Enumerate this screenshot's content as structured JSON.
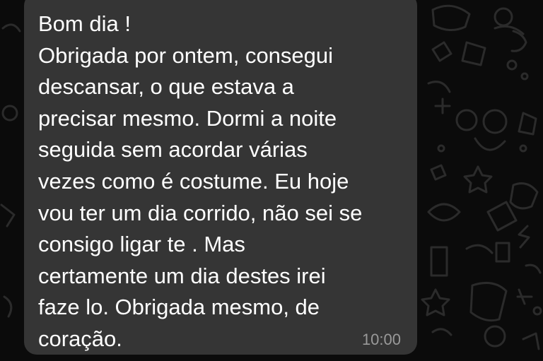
{
  "chat": {
    "background_color": "#0b0b0b",
    "wallpaper": "doodle-pattern"
  },
  "message": {
    "bubble_color": "#353535",
    "lines": [
      "Bom dia !",
      "Obrigada por ontem, consegui",
      "descansar, o que estava a",
      "precisar mesmo. Dormi a noite",
      "seguida sem acordar várias",
      "vezes como é costume. Eu hoje",
      "vou ter um dia corrido, não sei se",
      "consigo ligar te . Mas",
      "certamente um dia destes irei",
      "faze lo. Obrigada mesmo, de",
      "coração."
    ],
    "time": "10:00"
  }
}
